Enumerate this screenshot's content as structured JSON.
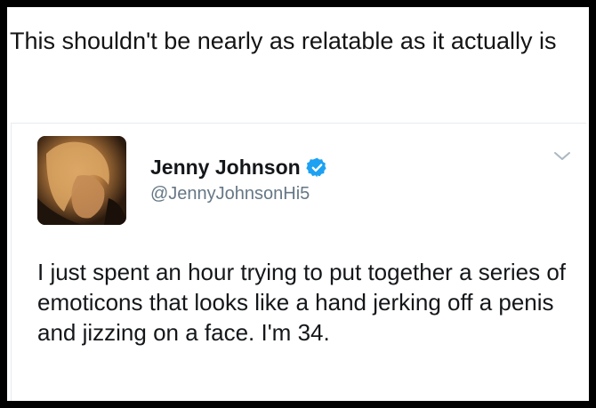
{
  "caption": "This shouldn't be nearly as relatable as it actually is",
  "tweet": {
    "display_name": "Jenny Johnson",
    "handle": "@JennyJohnsonHi5",
    "verified": true,
    "verified_icon": "verified-badge-icon",
    "menu_icon": "chevron-down-icon",
    "text": "I just spent an hour trying to put together a series of emoticons that looks like a hand jerking off a penis and jizzing on a face. I'm 34.",
    "colors": {
      "verified": "#1da1f2",
      "handle": "#657786",
      "text": "#14171a"
    }
  }
}
